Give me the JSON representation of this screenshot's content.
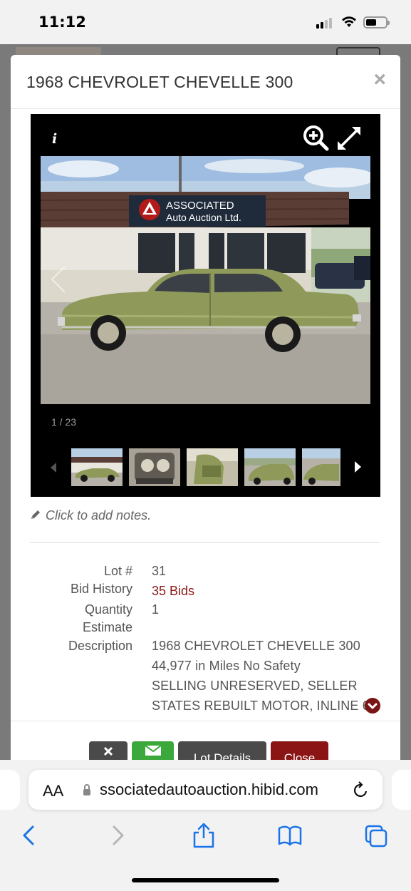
{
  "status_bar": {
    "time": "11:12"
  },
  "modal": {
    "title": "1968 CHEVROLET CHEVELLE 300",
    "close_label": "×",
    "viewer": {
      "info_label": "i",
      "counter": "1 / 23",
      "photo_sign_line1": "ASSOCIATED",
      "photo_sign_line2": "Auto Auction Ltd."
    },
    "notes": "Click to add notes.",
    "details": {
      "lot_label": "Lot #",
      "lot_value": "31",
      "bid_history_label": "Bid History",
      "bid_history_value": "35 Bids",
      "quantity_label": "Quantity",
      "quantity_value": "1",
      "estimate_label": "Estimate",
      "estimate_value": "",
      "description_label": "Description",
      "description_lines": [
        "1968 CHEVROLET CHEVELLE 300",
        "44,977 in Miles No Safety",
        "SELLING UNRESERVED, SELLER",
        "STATES REBUILT MOTOR, INLINE 6"
      ]
    },
    "footer": {
      "lot_details_label": "Lot Details",
      "close_label": "Close"
    }
  },
  "safari": {
    "text_size_label": "AA",
    "url": "ssociatedautoauction.hibid.com"
  },
  "colors": {
    "bid_link": "#8b1a1a",
    "green_button": "#3aa83a",
    "grey_button": "#4a4a4a",
    "close_button": "#8b1515",
    "ios_blue": "#1a73e8"
  }
}
